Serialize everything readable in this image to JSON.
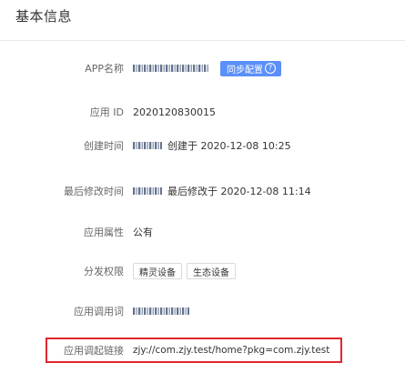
{
  "section": {
    "title": "基本信息"
  },
  "fields": {
    "app_name": {
      "label": "APP名称",
      "sync_button": "同步配置",
      "sync_icon": "help-circle-icon"
    },
    "app_id": {
      "label": "应用 ID",
      "value": "2020120830015"
    },
    "created": {
      "label": "创建时间",
      "meta": "创建于 2020-12-08 10:25"
    },
    "modified": {
      "label": "最后修改时间",
      "meta": "最后修改于 2020-12-08 11:14"
    },
    "attribute": {
      "label": "应用属性",
      "value": "公有"
    },
    "distribution": {
      "label": "分发权限",
      "tags": [
        "精灵设备",
        "生态设备"
      ]
    },
    "invoke_word": {
      "label": "应用调用词"
    },
    "deeplink": {
      "label": "应用调起链接",
      "value": "zjy://com.zjy.test/home?pkg=com.zjy.test"
    }
  },
  "colors": {
    "accent": "#5b8ff9",
    "highlight": "#e0262f"
  }
}
